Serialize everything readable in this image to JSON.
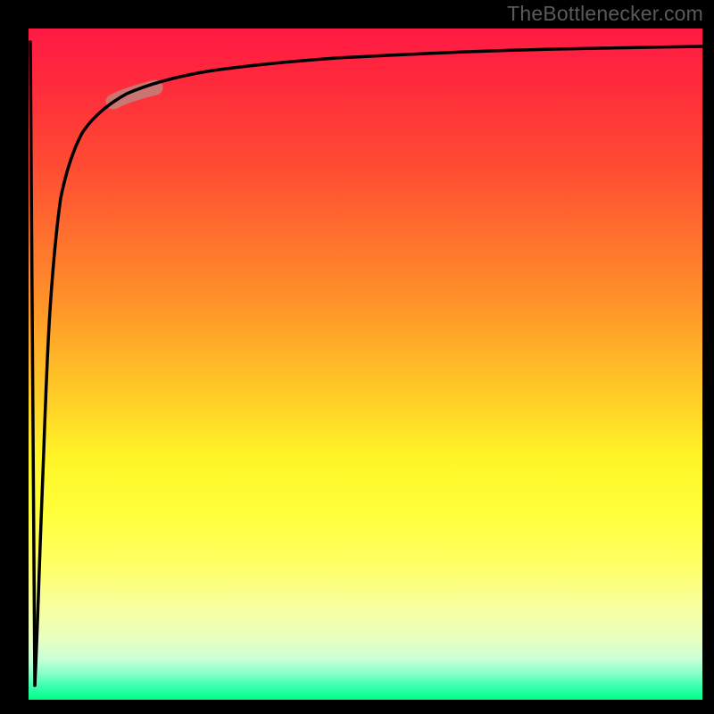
{
  "watermark": "TheBottlenecker.com",
  "chart_data": {
    "type": "line",
    "title": "",
    "xlabel": "",
    "ylabel": "",
    "xlim": [
      0,
      100
    ],
    "ylim": [
      0,
      100
    ],
    "background_gradient": {
      "orientation": "vertical",
      "stops": [
        {
          "pos": 0.0,
          "color": "#ff1a44"
        },
        {
          "pos": 0.2,
          "color": "#ff4a33"
        },
        {
          "pos": 0.4,
          "color": "#ff8f2a"
        },
        {
          "pos": 0.56,
          "color": "#ffd227"
        },
        {
          "pos": 0.72,
          "color": "#ffff3a"
        },
        {
          "pos": 0.94,
          "color": "#c8ffd8"
        },
        {
          "pos": 1.0,
          "color": "#00ff88"
        }
      ]
    },
    "series": [
      {
        "name": "curve",
        "color": "#000000",
        "x": [
          0.5,
          0.8,
          1.2,
          1.8,
          2.2,
          2.6,
          3.0,
          3.4,
          3.8,
          4.4,
          5.2,
          6.2,
          7.5,
          9.0,
          11.0,
          13.0,
          15.5,
          18.0,
          21.0,
          24.0,
          28.0,
          32.0,
          37.0,
          43.0,
          50.0,
          58.0,
          67.0,
          76.0,
          86.0,
          95.0,
          100.0
        ],
        "y": [
          2.0,
          8.0,
          20.0,
          38.0,
          50.0,
          58.0,
          64.0,
          69.0,
          73.0,
          77.0,
          80.5,
          83.0,
          85.2,
          87.0,
          88.4,
          89.5,
          90.5,
          91.3,
          92.0,
          92.6,
          93.2,
          93.8,
          94.3,
          94.8,
          95.3,
          95.7,
          96.1,
          96.4,
          96.7,
          96.9,
          97.0
        ]
      },
      {
        "name": "initial-drop",
        "color": "#000000",
        "x": [
          0.0,
          0.5
        ],
        "y": [
          98.0,
          2.0
        ]
      }
    ],
    "highlight_segment": {
      "color": "#c47d78",
      "x_range": [
        12.0,
        18.5
      ],
      "y_range": [
        89.0,
        91.5
      ]
    }
  }
}
